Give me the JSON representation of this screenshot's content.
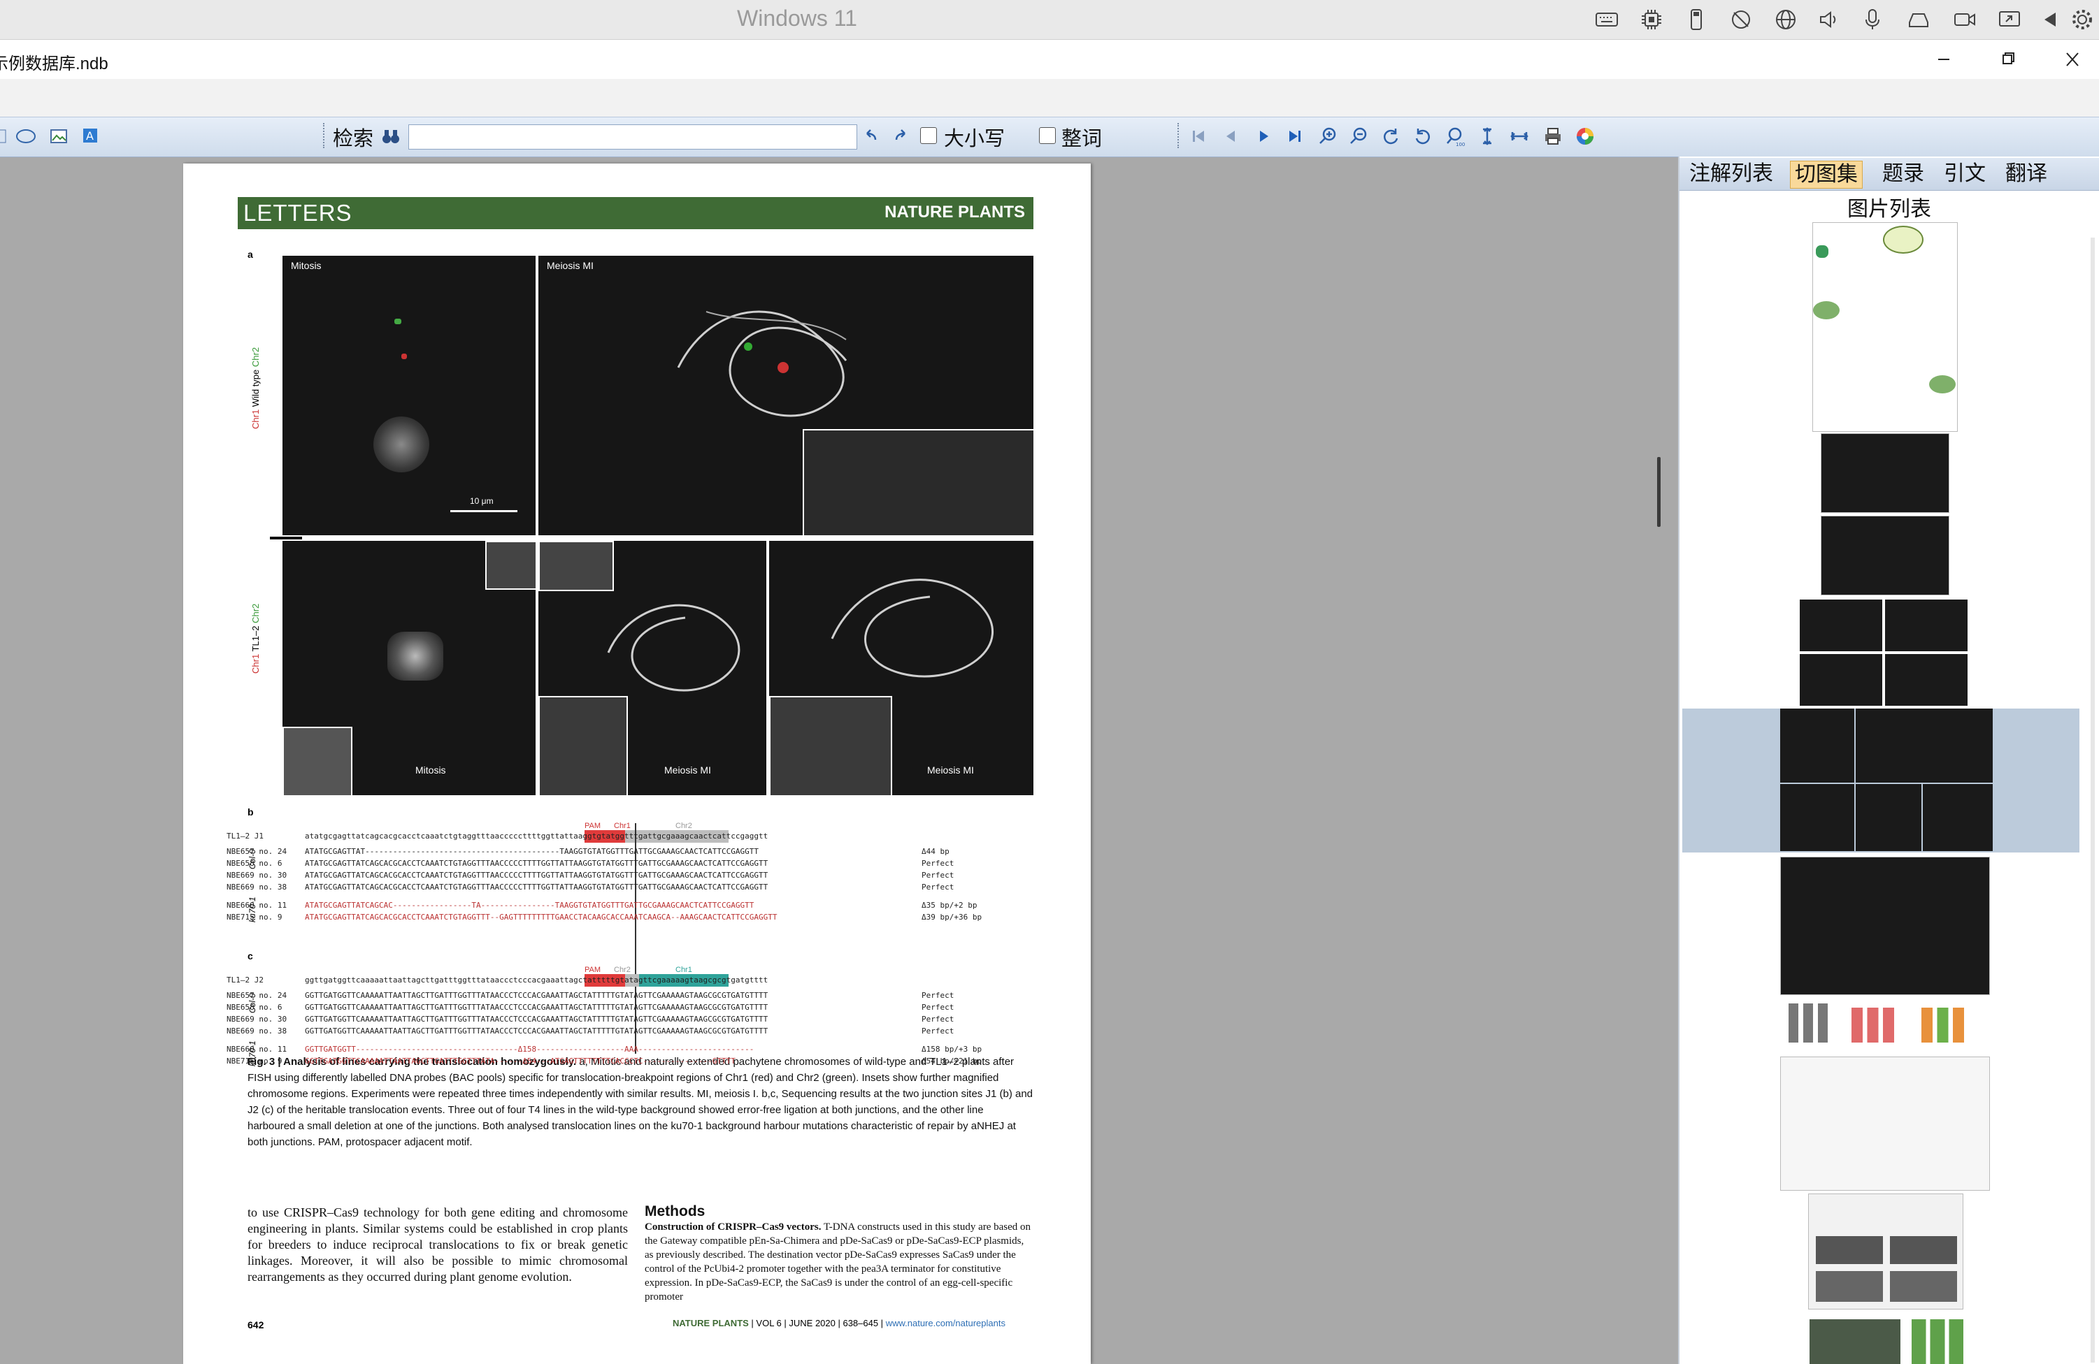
{
  "vm_bar": {
    "title": "Windows 11"
  },
  "app": {
    "title": "示例数据库.ndb"
  },
  "toolbar": {
    "search_label": "检索",
    "search_value": "",
    "match_case_label": "大小写",
    "whole_word_label": "整词"
  },
  "panel": {
    "tabs": [
      "注解列表",
      "切图集",
      "题录",
      "引文",
      "翻译"
    ],
    "active_tab": 1,
    "subtitle": "图片列表"
  },
  "paper": {
    "section": "LETTERS",
    "journal": "NATURE PLANTS",
    "panel_a": "a",
    "panel_b": "b",
    "panel_c": "c",
    "mitosis": "Mitosis",
    "meiosis_mi_top": "Meiosis MI",
    "scale": "10 μm",
    "row1_label": "Wild type",
    "row2_label": "TL1–2",
    "chr1": "Chr1",
    "chr2": "Chr2",
    "mitosis_b": "Mitosis",
    "meiosis_b1": "Meiosis MI",
    "meiosis_b2": "Meiosis MI",
    "pam": "PAM",
    "b_ref_name": "TL1–2 J1",
    "b_ref_seq": "atatgcgagttatcagcacgcacctcaaatctgtaggtttaacccccttttggttattaaggtgtatggtttgattgcgaaagcaactcattccgaggtt",
    "b_rows": [
      {
        "name": "NBE657 no. 24",
        "seq": "ATATGCGAGTTAT------------------------------------------TAAGGTGTATGGTTTGATTGCGAAAGCAACTCATTCCGAGGTT",
        "res": "Δ44 bp"
      },
      {
        "name": "NBE658 no. 6",
        "seq": "ATATGCGAGTTATCAGCACGCACCTCAAATCTGTAGGTTTAACCCCCTTTTGGTTATTAAGGTGTATGGTTTGATTGCGAAAGCAACTCATTCCGAGGTT",
        "res": "Perfect"
      },
      {
        "name": "NBE669 no. 30",
        "seq": "ATATGCGAGTTATCAGCACGCACCTCAAATCTGTAGGTTTAACCCCCTTTTGGTTATTAAGGTGTATGGTTTGATTGCGAAAGCAACTCATTCCGAGGTT",
        "res": "Perfect"
      },
      {
        "name": "NBE669 no. 38",
        "seq": "ATATGCGAGTTATCAGCACGCACCTCAAATCTGTAGGTTTAACCCCCTTTTGGTTATTAAGGTGTATGGTTTGATTGCGAAAGCAACTCATTCCGAGGTT",
        "res": "Perfect"
      },
      {
        "name": "NBE660 no. 11",
        "seq": "ATATGCGAGTTATCAGCAC-----------------TA----------------TAAGGTGTATGGTTTGATTGCGAAAGCAACTCATTCCGAGGTT",
        "res": "Δ35 bp/+2 bp"
      },
      {
        "name": "NBE715 no. 9",
        "seq": "ATATGCGAGTTATCAGCACGCACCTCAAATCTGTAGGTTT--GAGTTTTTTTTTGAACCTACAAGCACCAAATCAAGCA--AAAGCAACTCATTCCGAGGTT",
        "res": "Δ39 bp/+36 bp"
      }
    ],
    "c_ref_name": "TL1–2 J2",
    "c_ref_seq": "ggttgatggttcaaaaattaattagcttgatttggtttataaccctcccacgaaattagctatttttgtatagttcgaaaaagtaagcgcgtgatgtttt",
    "c_rows": [
      {
        "name": "NBE657 no. 24",
        "seq": "GGTTGATGGTTCAAAAATTAATTAGCTTGATTTGGTTTATAACCCTCCCACGAAATTAGCTATTTTTGTATAGTTCGAAAAAGTAAGCGCGTGATGTTTT",
        "res": "Perfect"
      },
      {
        "name": "NBE658 no. 6",
        "seq": "GGTTGATGGTTCAAAAATTAATTAGCTTGATTTGGTTTATAACCCTCCCACGAAATTAGCTATTTTTGTATAGTTCGAAAAAGTAAGCGCGTGATGTTTT",
        "res": "Perfect"
      },
      {
        "name": "NBE669 no. 30",
        "seq": "GGTTGATGGTTCAAAAATTAATTAGCTTGATTTGGTTTATAACCCTCCCACGAAATTAGCTATTTTTGTATAGTTCGAAAAAGTAAGCGCGTGATGTTTT",
        "res": "Perfect"
      },
      {
        "name": "NBE669 no. 38",
        "seq": "GGTTGATGGTTCAAAAATTAATTAGCTTGATTTGGTTTATAACCCTCCCACGAAATTAGCTATTTTTGTATAGTTCGAAAAAGTAAGCGCGTGATGTTTT",
        "res": "Perfect"
      },
      {
        "name": "NBE660 no. 11",
        "seq": "GGTTGATGGTT-----------------------------------Δ158-------------------AAA-------------------------",
        "res": "Δ158 bp/+3 bp"
      },
      {
        "name": "NBE715 no. 9",
        "seq": "GGTTGATGGTTCAAAAATTAATTAGCTTGATTTGGTTTATA------Δ54---ATGAGTTTTTTTTCACCCTC---------------GTTTT",
        "res": "Δ54 bp/+21 bp"
      }
    ],
    "group_col0": "Col-0",
    "group_ku": "ku70-1",
    "caption_head": "Fig. 3 | Analysis of lines carrying the translocation homozygously.",
    "caption_body": " a, Mitotic and naturally extended pachytene chromosomes of wild-type and TL1–2 plants after FISH using differently labelled DNA probes (BAC pools) specific for translocation-breakpoint regions of Chr1 (red) and Chr2 (green). Insets show further magnified chromosome regions. Experiments were repeated three times independently with similar results. MI, meiosis I. b,c, Sequencing results at the two junction sites J1 (b) and J2 (c) of the heritable translocation events. Three out of four T4 lines in the wild-type background showed error-free ligation at both junctions, and the other line harboured a small deletion at one of the junctions. Both analysed translocation lines on the ku70-1 background harbour mutations characteristic of repair by aNHEJ at both junctions. PAM, protospacer adjacent motif.",
    "body_left": "to use CRISPR–Cas9 technology for both gene editing and chromosome engineering in plants. Similar systems could be established in crop plants for breeders to induce reciprocal translocations to fix or break genetic linkages. Moreover, it will also be possible to mimic chromosomal rearrangements as they occurred during plant genome evolution.",
    "methods_head": "Methods",
    "methods_sub": "Construction of CRISPR–Cas9 vectors.",
    "methods_body": " T-DNA constructs used in this study are based on the Gateway compatible pEn-Sa-Chimera and pDe-SaCas9 or pDe-SaCas9-ECP plasmids, as previously described. The destination vector pDe-SaCas9 expresses SaCas9 under the control of the PcUbi4-2 promoter together with the pea3A terminator for constitutive expression. In pDe-SaCas9-ECP, the SaCas9 is under the control of an egg-cell-specific promoter",
    "page_no": "642",
    "footer_journal": "NATURE PLANTS",
    "footer_info": " | VOL 6 | JUNE 2020 | 638–645 | ",
    "footer_url": "www.nature.com/natureplants"
  },
  "colors": {
    "journal_green": "#3f6b35",
    "toolbar_blue": "#cfdcec",
    "active_tab": "#f9d99a",
    "pam_red": "#e03b3b",
    "chr2_teal": "#2fa39a"
  }
}
